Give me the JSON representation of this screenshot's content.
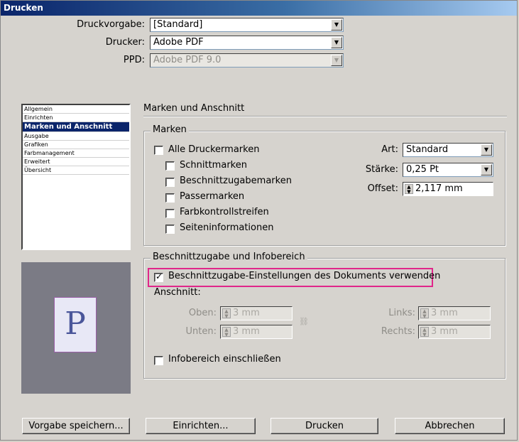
{
  "window": {
    "title": "Drucken"
  },
  "top": {
    "druckvorgabe_label": "Druckvorgabe:",
    "druckvorgabe_value": "[Standard]",
    "drucker_label": "Drucker:",
    "drucker_value": "Adobe PDF",
    "ppd_label": "PPD:",
    "ppd_value": "Adobe PDF 9.0"
  },
  "sidebar": {
    "items": [
      {
        "label": "Allgemein"
      },
      {
        "label": "Einrichten"
      },
      {
        "label": "Marken und Anschnitt"
      },
      {
        "label": "Ausgabe"
      },
      {
        "label": "Grafiken"
      },
      {
        "label": "Farbmanagement"
      },
      {
        "label": "Erweitert"
      },
      {
        "label": "Übersicht"
      }
    ],
    "selected_index": 2
  },
  "preview": {
    "letter": "P"
  },
  "section": {
    "title": "Marken und Anschnitt"
  },
  "marken": {
    "group_label": "Marken",
    "checkboxes": [
      {
        "label": "Alle Druckermarken",
        "checked": false
      },
      {
        "label": "Schnittmarken",
        "checked": false
      },
      {
        "label": "Beschnittzugabemarken",
        "checked": false
      },
      {
        "label": "Passermarken",
        "checked": false
      },
      {
        "label": "Farbkontrollstreifen",
        "checked": false
      },
      {
        "label": "Seiteninformationen",
        "checked": false
      }
    ],
    "art_label": "Art:",
    "art_value": "Standard",
    "staerke_label": "Stärke:",
    "staerke_value": "0,25 Pt",
    "offset_label": "Offset:",
    "offset_value": "2,117 mm"
  },
  "beschnitt": {
    "group_label": "Beschnittzugabe und Infobereich",
    "use_doc_label": "Beschnittzugabe-Einstellungen des Dokuments verwenden",
    "use_doc_checked": true,
    "anschnitt_label": "Anschnitt:",
    "oben_label": "Oben:",
    "oben_value": "3 mm",
    "unten_label": "Unten:",
    "unten_value": "3 mm",
    "links_label": "Links:",
    "links_value": "3 mm",
    "rechts_label": "Rechts:",
    "rechts_value": "3 mm",
    "infobereich_label": "Infobereich einschließen",
    "infobereich_checked": false
  },
  "buttons": {
    "save_preset": "Vorgabe speichern...",
    "setup": "Einrichten...",
    "print": "Drucken",
    "cancel": "Abbrechen"
  },
  "colors": {
    "highlight": "#e0268a",
    "selection": "#0a246a",
    "title_bar": "#0a246a"
  }
}
